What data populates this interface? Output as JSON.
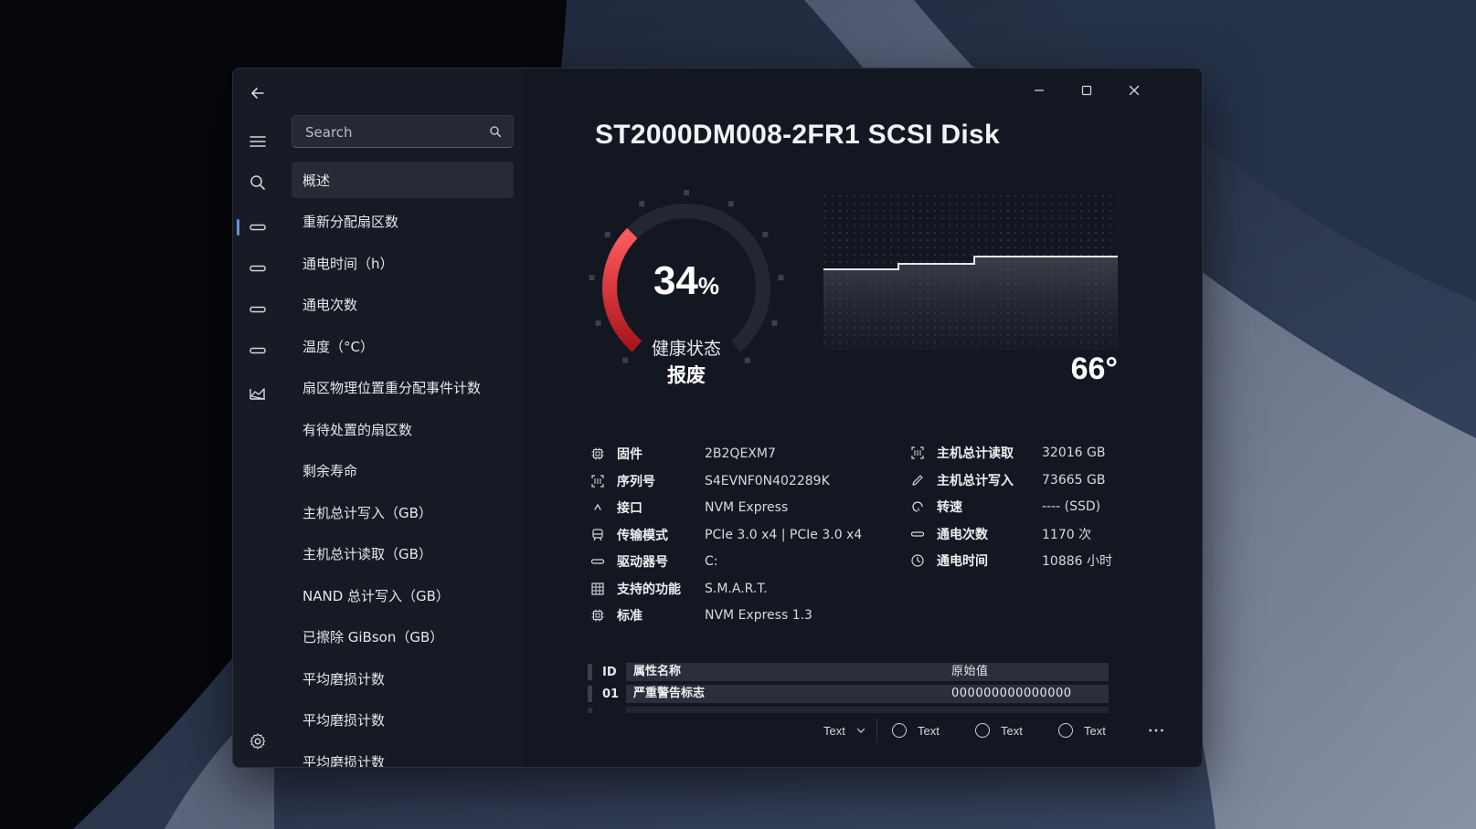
{
  "window": {
    "search_placeholder": "Search",
    "nav_items": [
      "概述",
      "重新分配扇区数",
      "通电时间（h）",
      "通电次数",
      "温度（°C）",
      "扇区物理位置重分配事件计数",
      "有待处置的扇区数",
      "剩余寿命",
      "主机总计写入（GB）",
      "主机总计读取（GB）",
      "NAND 总计写入（GB）",
      "已擦除 GiBson（GB）",
      "平均磨损计数",
      "平均磨损计数",
      "平均磨损计数"
    ],
    "active_nav_index": 0
  },
  "disk": {
    "title": "ST2000DM008-2FR1 SCSI Disk",
    "health": {
      "percent": "34",
      "percent_unit": "%",
      "percent_value": 34,
      "label": "健康状态",
      "status": "报废"
    },
    "temperature": {
      "value": "66°"
    },
    "info_left": [
      {
        "icon": "chip-icon",
        "label": "固件",
        "value": "2B2QEXM7"
      },
      {
        "icon": "scan-icon",
        "label": "序列号",
        "value": "S4EVNF0N402289K"
      },
      {
        "icon": "caret-up-icon",
        "label": "接口",
        "value": "NVM Express"
      },
      {
        "icon": "transfer-icon",
        "label": "传输模式",
        "value": "PCIe 3.0 x4 | PCIe 3.0 x4"
      },
      {
        "icon": "drive-icon",
        "label": "驱动器号",
        "value": "C:"
      },
      {
        "icon": "grid-icon",
        "label": "支持的功能",
        "value": "S.M.A.R.T."
      },
      {
        "icon": "chip-icon",
        "label": "标准",
        "value": "NVM Express 1.3"
      }
    ],
    "info_right": [
      {
        "icon": "scan-icon",
        "label": "主机总计读取",
        "value": "32016 GB"
      },
      {
        "icon": "pencil-icon",
        "label": "主机总计写入",
        "value": "73665 GB"
      },
      {
        "icon": "rotate-icon",
        "label": "转速",
        "value": "---- (SSD)"
      },
      {
        "icon": "drive-icon",
        "label": "通电次数",
        "value": "1170 次"
      },
      {
        "icon": "clock-icon",
        "label": "通电时间",
        "value": "10886 小时"
      }
    ],
    "smart_table": {
      "headers": {
        "id": "ID",
        "name": "属性名称",
        "raw": "原始值"
      },
      "rows": [
        {
          "id": "01",
          "name": "严重警告标志",
          "raw": "000000000000000"
        }
      ]
    }
  },
  "command_bar": {
    "dropdown_label": "Text",
    "radio_labels": [
      "Text",
      "Text",
      "Text"
    ]
  },
  "colors": {
    "accent": "#6a8fd8",
    "gauge_red": "#d9333a",
    "track": "#232733"
  }
}
